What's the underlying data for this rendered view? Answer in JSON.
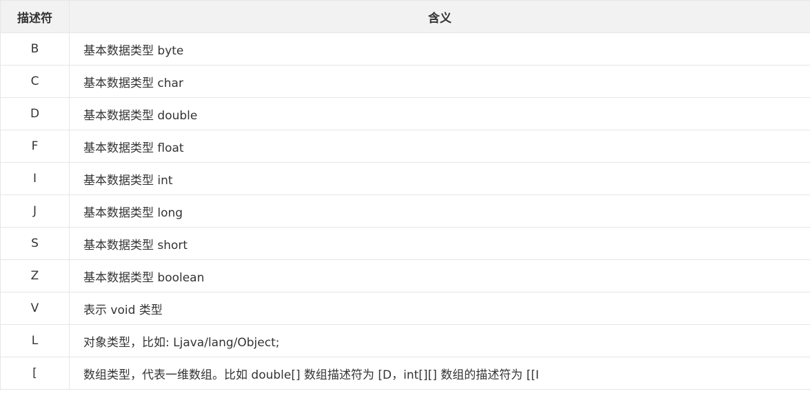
{
  "table": {
    "headers": [
      "描述符",
      "含义"
    ],
    "rows": [
      {
        "code": "B",
        "meaning": "基本数据类型 byte"
      },
      {
        "code": "C",
        "meaning": "基本数据类型 char"
      },
      {
        "code": "D",
        "meaning": "基本数据类型 double"
      },
      {
        "code": "F",
        "meaning": "基本数据类型 float"
      },
      {
        "code": "I",
        "meaning": "基本数据类型 int"
      },
      {
        "code": "J",
        "meaning": "基本数据类型 long"
      },
      {
        "code": "S",
        "meaning": "基本数据类型 short"
      },
      {
        "code": "Z",
        "meaning": "基本数据类型 boolean"
      },
      {
        "code": "V",
        "meaning": "表示 void 类型"
      },
      {
        "code": "L",
        "meaning": "对象类型，比如: Ljava/lang/Object;"
      },
      {
        "code": "[",
        "meaning": "数组类型，代表一维数组。比如 double[] 数组描述符为 [D，int[][] 数组的描述符为 [[I"
      }
    ]
  },
  "colors": {
    "header_bg": "#f2f2f2",
    "border": "#e6e6e6",
    "text": "#333333"
  }
}
